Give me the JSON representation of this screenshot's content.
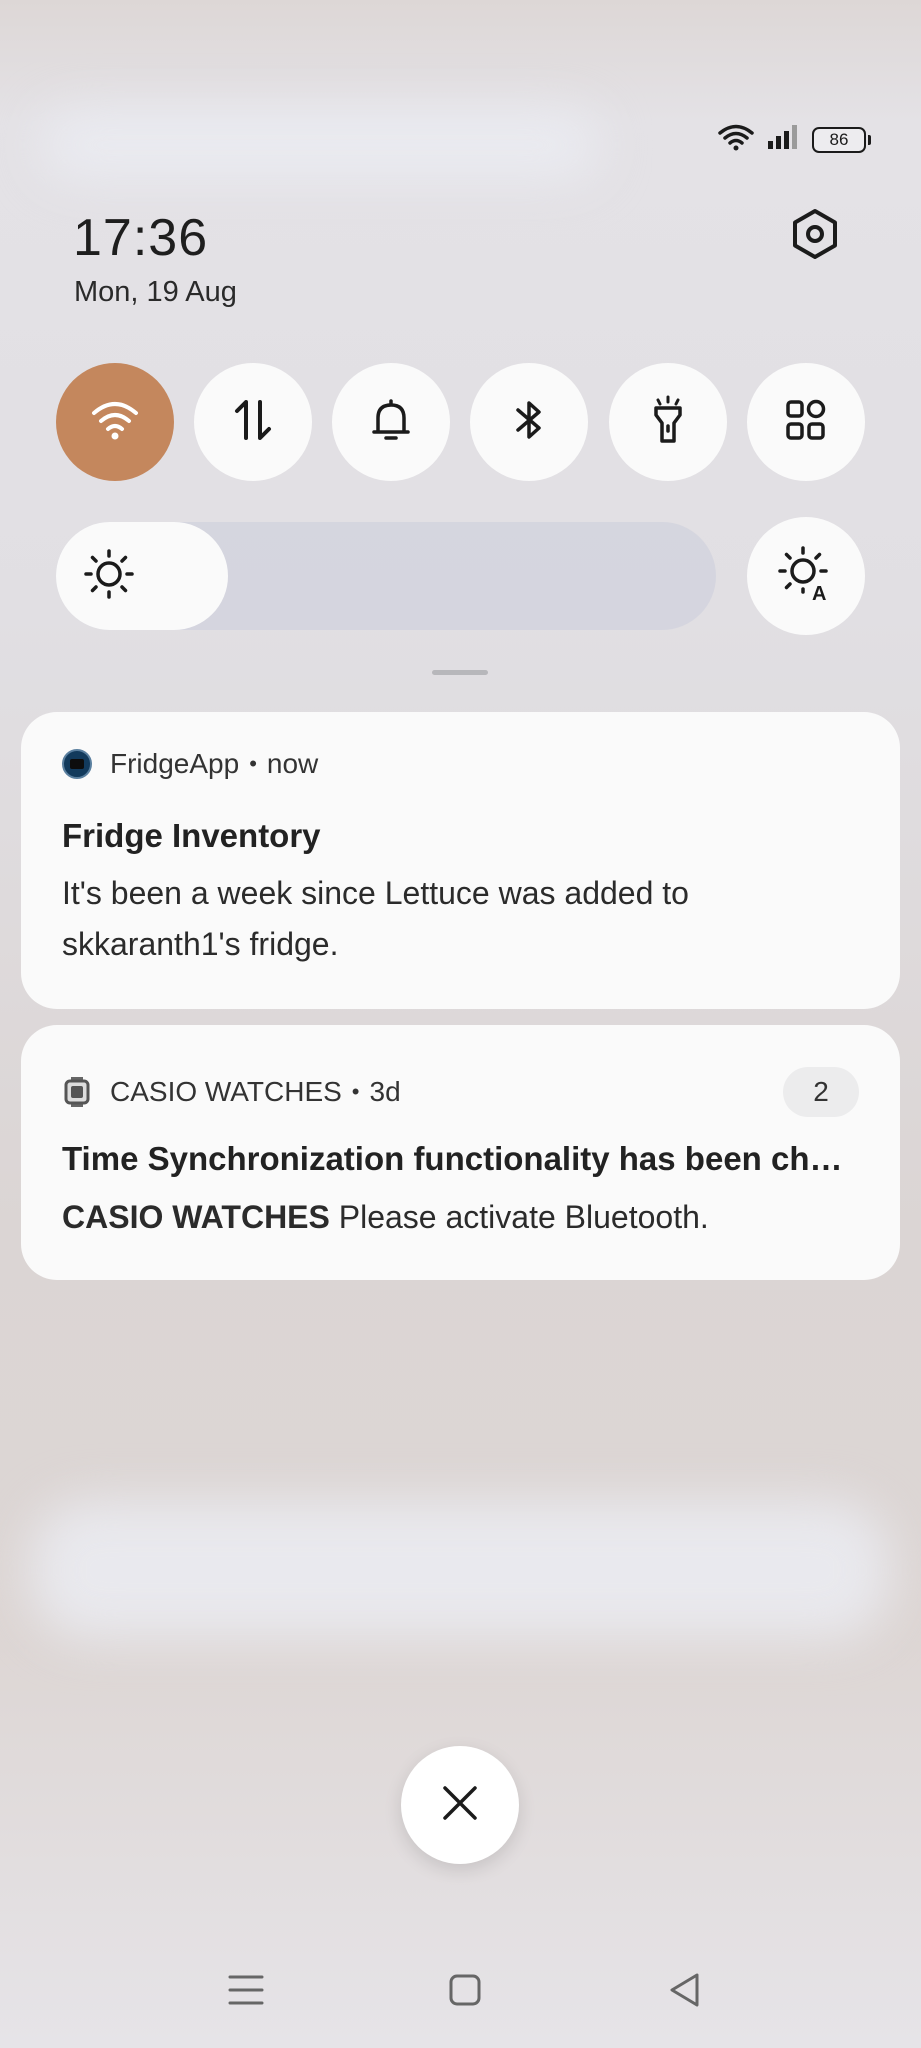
{
  "status_bar": {
    "battery_level": "86",
    "wifi_icon": "wifi-icon",
    "signal_icon": "cellular-signal-icon"
  },
  "header": {
    "time": "17:36",
    "date": "Mon, 19 Aug",
    "settings_icon": "settings-hexagon-icon"
  },
  "quick_toggles": [
    {
      "name": "wifi",
      "icon": "wifi-icon",
      "active": true
    },
    {
      "name": "mobile-data",
      "icon": "data-arrows-icon",
      "active": false
    },
    {
      "name": "sound",
      "icon": "bell-icon",
      "active": false
    },
    {
      "name": "bluetooth",
      "icon": "bluetooth-icon",
      "active": false
    },
    {
      "name": "flashlight",
      "icon": "flashlight-icon",
      "active": false
    },
    {
      "name": "more",
      "icon": "grid-icon",
      "active": false
    }
  ],
  "brightness": {
    "level": 0.18,
    "icon": "sun-icon",
    "auto_icon": "auto-brightness-icon"
  },
  "notifications": [
    {
      "app": "FridgeApp",
      "separator": "•",
      "time": "now",
      "title": "Fridge Inventory",
      "body": "It's been a week since Lettuce was added to skkaranth1's fridge."
    },
    {
      "app": "CASIO WATCHES",
      "separator": "•",
      "time": "3d",
      "count": "2",
      "title": "Time Synchronization functionality has been ch…",
      "body_app": "CASIO WATCHES",
      "body": "Please activate Bluetooth."
    }
  ],
  "colors": {
    "accent": "#c4875d",
    "card": "#fafafa"
  }
}
